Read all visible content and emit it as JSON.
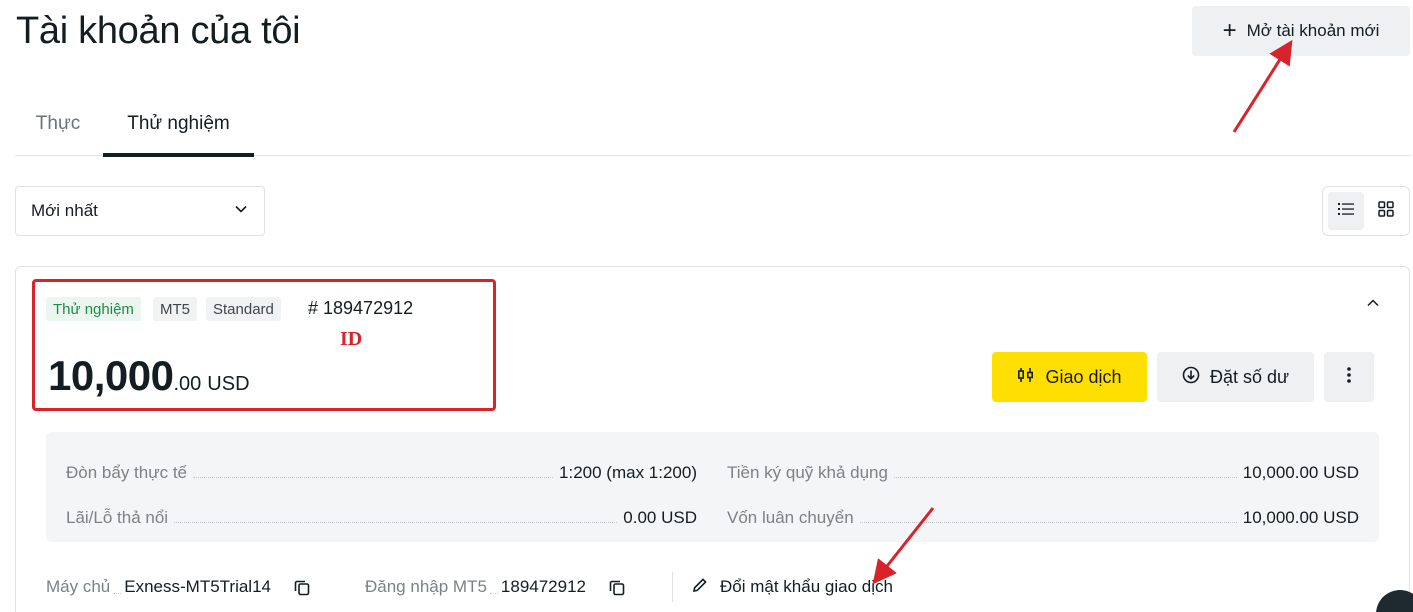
{
  "header": {
    "title": "Tài khoản của tôi",
    "open_account_label": "Mở tài khoản mới"
  },
  "tabs": [
    {
      "label": "Thực",
      "active": false
    },
    {
      "label": "Thử nghiệm",
      "active": true
    }
  ],
  "sort": {
    "selected": "Mới nhất"
  },
  "view_toggle": {
    "active": "list"
  },
  "account": {
    "badges": {
      "type": "Thử nghiệm",
      "platform": "MT5",
      "account_type": "Standard"
    },
    "id_label": "# 189472912",
    "id_annotation": "ID",
    "balance_int": "10,000",
    "balance_dec": ".00",
    "balance_currency": "USD",
    "actions": {
      "trade": "Giao dịch",
      "set_balance": "Đặt số dư"
    },
    "stats": [
      {
        "label": "Đòn bẩy thực tế",
        "value": "1:200 (max 1:200)"
      },
      {
        "label": "Tiền ký quỹ khả dụng",
        "value": "10,000.00 USD"
      },
      {
        "label": "Lãi/Lỗ thả nổi",
        "value": "0.00 USD"
      },
      {
        "label": "Vốn luân chuyển",
        "value": "10,000.00 USD"
      }
    ],
    "server": {
      "label": "Máy chủ",
      "value": "Exness-MT5Trial14"
    },
    "login": {
      "label": "Đăng nhập MT5",
      "value": "189472912"
    },
    "change_password": "Đổi mật khẩu giao dịch"
  },
  "colors": {
    "accent_yellow": "#ffde02",
    "annotation_red": "#d9232b",
    "demo_green": "#1c8c4a"
  }
}
